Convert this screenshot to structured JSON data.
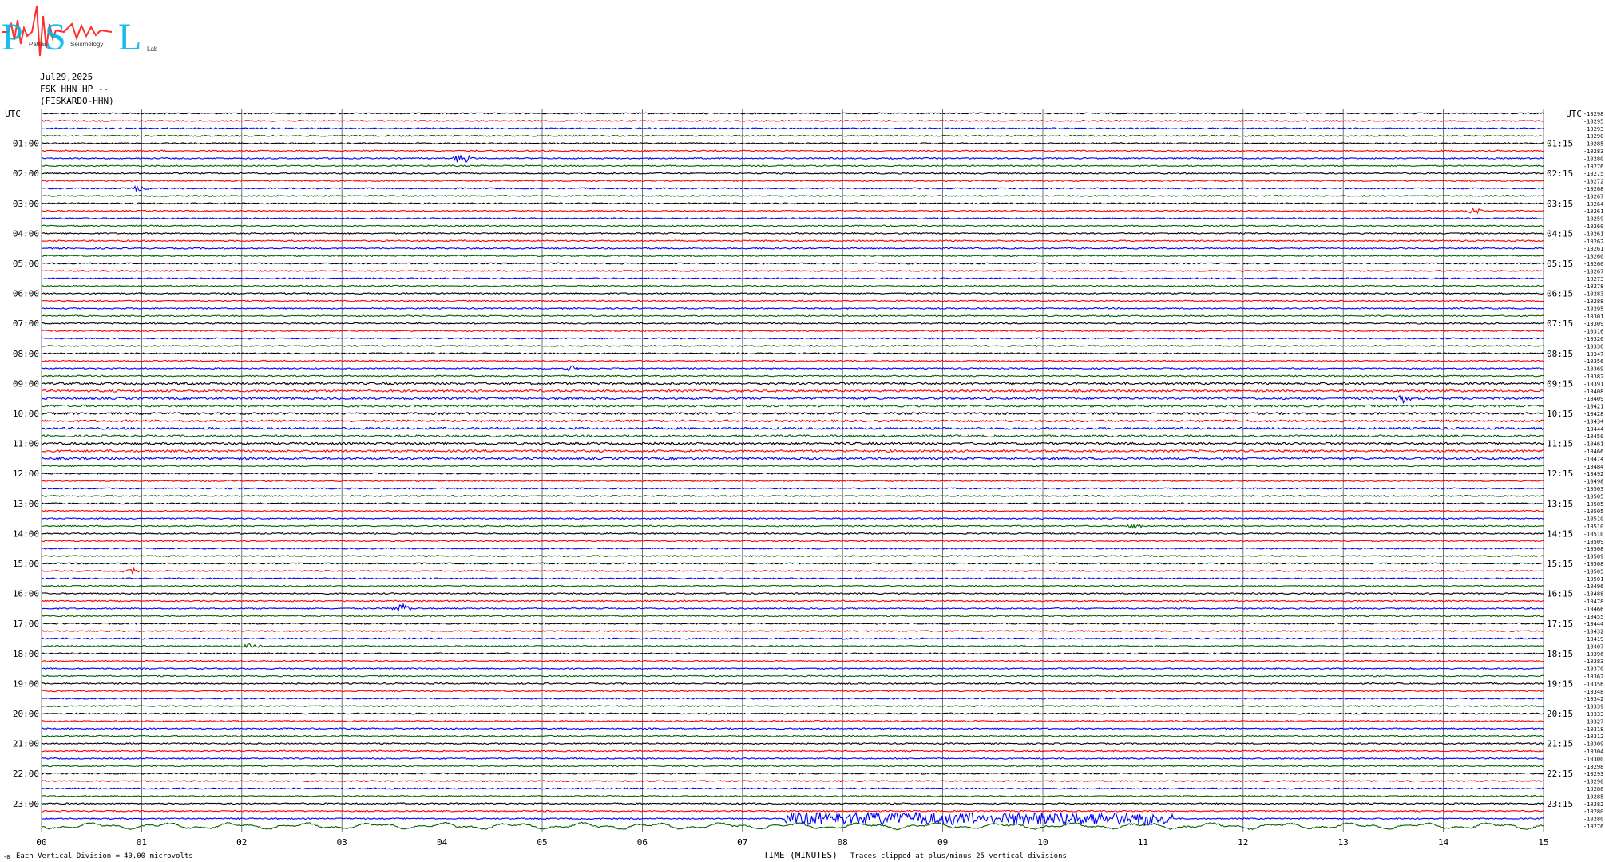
{
  "logo": {
    "letters": [
      "P",
      "S",
      "L"
    ],
    "subtext": [
      "Patras",
      "Seismology",
      "Lab"
    ]
  },
  "header": {
    "date": "Jul29,2025",
    "station": "FSK HHN HP --",
    "site": "(FISKARDO-HHN)"
  },
  "footer": {
    "division": "Each Vertical Division =",
    "division_value": "40.00 microvolts",
    "xlabel": "TIME (MINUTES)",
    "clip_note": "Traces clipped at plus/minus 25 vertical divisions",
    "corner_mark": "-8"
  },
  "chart_data": {
    "type": "line",
    "title": "",
    "xlabel": "TIME (MINUTES)",
    "ylabel": "UTC",
    "x_ticks": [
      "00",
      "01",
      "02",
      "03",
      "04",
      "05",
      "06",
      "07",
      "08",
      "09",
      "10",
      "11",
      "12",
      "13",
      "14",
      "15"
    ],
    "xlim": [
      0,
      15
    ],
    "grid": true,
    "left_axis_title": "UTC",
    "right_axis_title": "UTC",
    "left_hour_labels": [
      "01:00",
      "02:00",
      "03:00",
      "04:00",
      "05:00",
      "06:00",
      "07:00",
      "08:00",
      "09:00",
      "10:00",
      "11:00",
      "12:00",
      "13:00",
      "14:00",
      "15:00",
      "16:00",
      "17:00",
      "18:00",
      "19:00",
      "20:00",
      "21:00",
      "22:00",
      "23:00"
    ],
    "right_hour_labels": [
      "01:15",
      "02:15",
      "03:15",
      "04:15",
      "05:15",
      "06:15",
      "07:15",
      "08:15",
      "09:15",
      "10:15",
      "11:15",
      "12:15",
      "13:15",
      "14:15",
      "15:15",
      "16:15",
      "17:15",
      "18:15",
      "19:15",
      "20:15",
      "21:15",
      "22:15",
      "23:15"
    ],
    "trace_count": 96,
    "traces_per_hour": 4,
    "trace_color_cycle": [
      "#000000",
      "#ff0000",
      "#0000ff",
      "#006400"
    ],
    "right_offset_labels": [
      "-10298",
      "-10295",
      "-10293",
      "-10290",
      "-10285",
      "-10283",
      "-10280",
      "-10276",
      "-10275",
      "-10272",
      "-10268",
      "-10267",
      "-10264",
      "-10261",
      "-10259",
      "-10260",
      "-10261",
      "-10262",
      "-10261",
      "-10260",
      "-10260",
      "-10267",
      "-10273",
      "-10278",
      "-10283",
      "-10288",
      "-10295",
      "-10301",
      "-10309",
      "-10316",
      "-10326",
      "-10336",
      "-10347",
      "-10356",
      "-10369",
      "-10382",
      "-10391",
      "-10408",
      "-10409",
      "-10421",
      "-10428",
      "-10434",
      "-10444",
      "-10450",
      "-10461",
      "-10466",
      "-10474",
      "-10484",
      "-10492",
      "-10498",
      "-10503",
      "-10505",
      "-10505",
      "-10505",
      "-10510",
      "-10510",
      "-10510",
      "-10509",
      "-10508",
      "-10509",
      "-10508",
      "-10505",
      "-10501",
      "-10496",
      "-10488",
      "-10478",
      "-10466",
      "-10455",
      "-10444",
      "-10432",
      "-10419",
      "-10407",
      "-10396",
      "-10383",
      "-10370",
      "-10362",
      "-10356",
      "-10348",
      "-10342",
      "-10339",
      "-10333",
      "-10327",
      "-10318",
      "-10312",
      "-10309",
      "-10304",
      "-10300",
      "-10298",
      "-10293",
      "-10290",
      "-10286",
      "-10285",
      "-10282",
      "-10280",
      "-10280",
      "-10276"
    ],
    "events": [
      {
        "trace": 6,
        "minute": 4.2,
        "amplitude": 2.5
      },
      {
        "trace": 10,
        "minute": 1.0,
        "amplitude": 1.5
      },
      {
        "trace": 13,
        "minute": 14.3,
        "amplitude": 1.5
      },
      {
        "trace": 61,
        "minute": 0.9,
        "amplitude": 1.5
      },
      {
        "trace": 66,
        "minute": 3.6,
        "amplitude": 2.5
      },
      {
        "trace": 71,
        "minute": 2.1,
        "amplitude": 1.5
      },
      {
        "trace": 55,
        "minute": 10.9,
        "amplitude": 1.5
      },
      {
        "trace": 38,
        "minute": 13.6,
        "amplitude": 1.5
      },
      {
        "trace": 34,
        "minute": 5.3,
        "amplitude": 1.2
      }
    ],
    "noisy_segment": {
      "trace": 94,
      "from_minute": 7.4,
      "to_minute": 11.3,
      "amplitude": 8
    }
  }
}
